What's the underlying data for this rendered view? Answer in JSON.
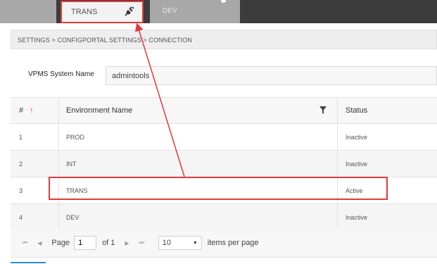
{
  "tabs": {
    "trans_label": "TRANS",
    "dev_label": "DEV",
    "trans_icon": "plug-icon"
  },
  "breadcrumb": "SETTINGS > CONFIGPORTAL SETTINGS > CONNECTION",
  "system": {
    "label": "VPMS System Name",
    "value": "admintools"
  },
  "grid": {
    "columns": {
      "num": "#",
      "env": "Environment Name",
      "status": "Status"
    },
    "rows": [
      {
        "num": "1",
        "env": "PROD",
        "status": "Inactive"
      },
      {
        "num": "2",
        "env": "INT",
        "status": "Inactive"
      },
      {
        "num": "3",
        "env": "TRANS",
        "status": "Active"
      },
      {
        "num": "4",
        "env": "DEV",
        "status": "Inactive"
      }
    ]
  },
  "pager": {
    "page_label": "Page",
    "page_value": "1",
    "of_label": "of 1",
    "page_size": "10",
    "items_per_page": "items per page"
  },
  "colors": {
    "highlight": "#e23a3a",
    "topbar": "#3c3c3c"
  }
}
